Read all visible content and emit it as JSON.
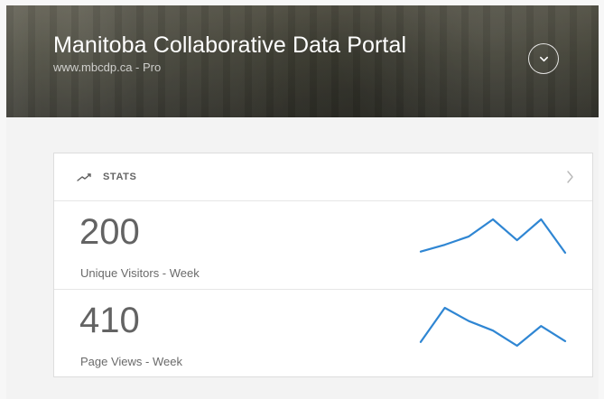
{
  "header": {
    "title": "Manitoba Collaborative Data Portal",
    "site_url": "www.mbcdp.ca",
    "separator": " - ",
    "plan": "Pro"
  },
  "stats_card": {
    "label": "STATS",
    "icon": "trend-up-icon",
    "chevron_icon": "chevron-right-icon"
  },
  "metrics": [
    {
      "value": "200",
      "label": "Unique Visitors - Week",
      "trend": [
        0.15,
        0.33,
        0.55,
        1.0,
        0.45,
        1.0,
        0.12
      ]
    },
    {
      "value": "410",
      "label": "Page Views - Week",
      "trend": [
        0.1,
        1.0,
        0.65,
        0.4,
        0.0,
        0.52,
        0.12
      ]
    }
  ],
  "colors": {
    "accent": "#2f86d3",
    "text_dark": "#636363",
    "text_muted": "#6a6a6a"
  }
}
